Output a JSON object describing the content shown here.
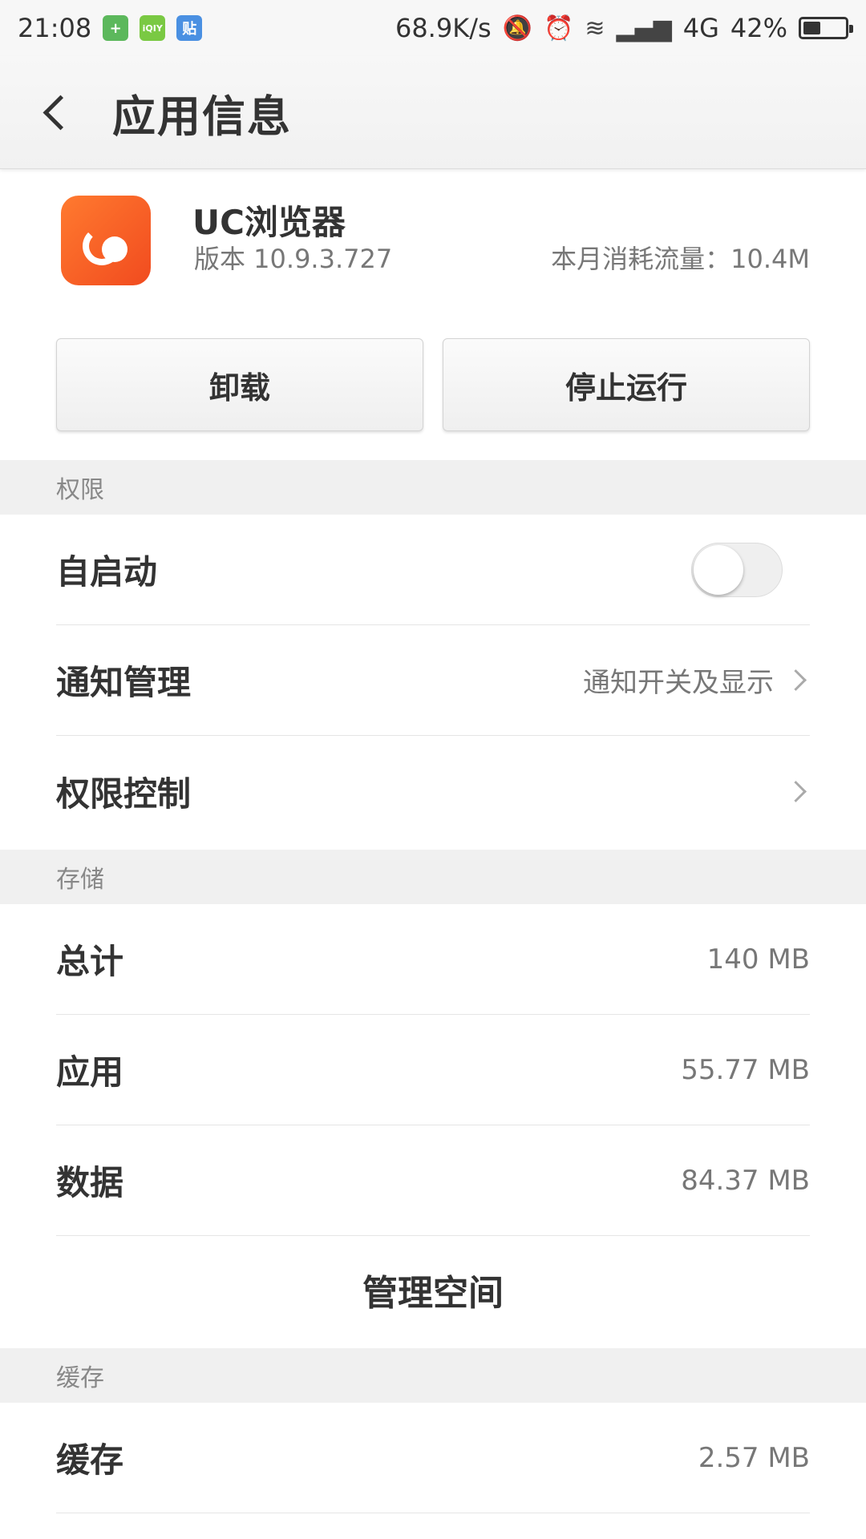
{
  "status_bar": {
    "time": "21:08",
    "notification_icons": [
      {
        "name": "shield-app-icon",
        "glyph": "+",
        "color": "#5cb85c"
      },
      {
        "name": "iqiyi-app-icon",
        "glyph": "iQIY",
        "color": "#7ac943"
      },
      {
        "name": "tieba-app-icon",
        "glyph": "贴",
        "color": "#4a90e2"
      }
    ],
    "network_speed": "68.9K/s",
    "network_type": "4G",
    "battery_percent": "42%",
    "battery_level": 0.42
  },
  "app_bar": {
    "title": "应用信息"
  },
  "app": {
    "name": "UC浏览器",
    "version": "版本 10.9.3.727",
    "traffic": "本月消耗流量：10.4M",
    "icon_colors": [
      "#ff7a2f",
      "#f14b1f"
    ]
  },
  "buttons": {
    "uninstall": "卸载",
    "stop": "停止运行"
  },
  "permissions": {
    "header": "权限",
    "auto_start": {
      "label": "自启动",
      "enabled": false
    },
    "notifications": {
      "label": "通知管理",
      "value": "通知开关及显示"
    },
    "permission_control": {
      "label": "权限控制"
    }
  },
  "storage": {
    "header": "存储",
    "total": {
      "label": "总计",
      "value": "140 MB"
    },
    "app": {
      "label": "应用",
      "value": "55.77 MB"
    },
    "data": {
      "label": "数据",
      "value": "84.37 MB"
    },
    "manage_space": "管理空间"
  },
  "cache": {
    "header": "缓存",
    "cache": {
      "label": "缓存",
      "value": "2.57 MB"
    }
  }
}
